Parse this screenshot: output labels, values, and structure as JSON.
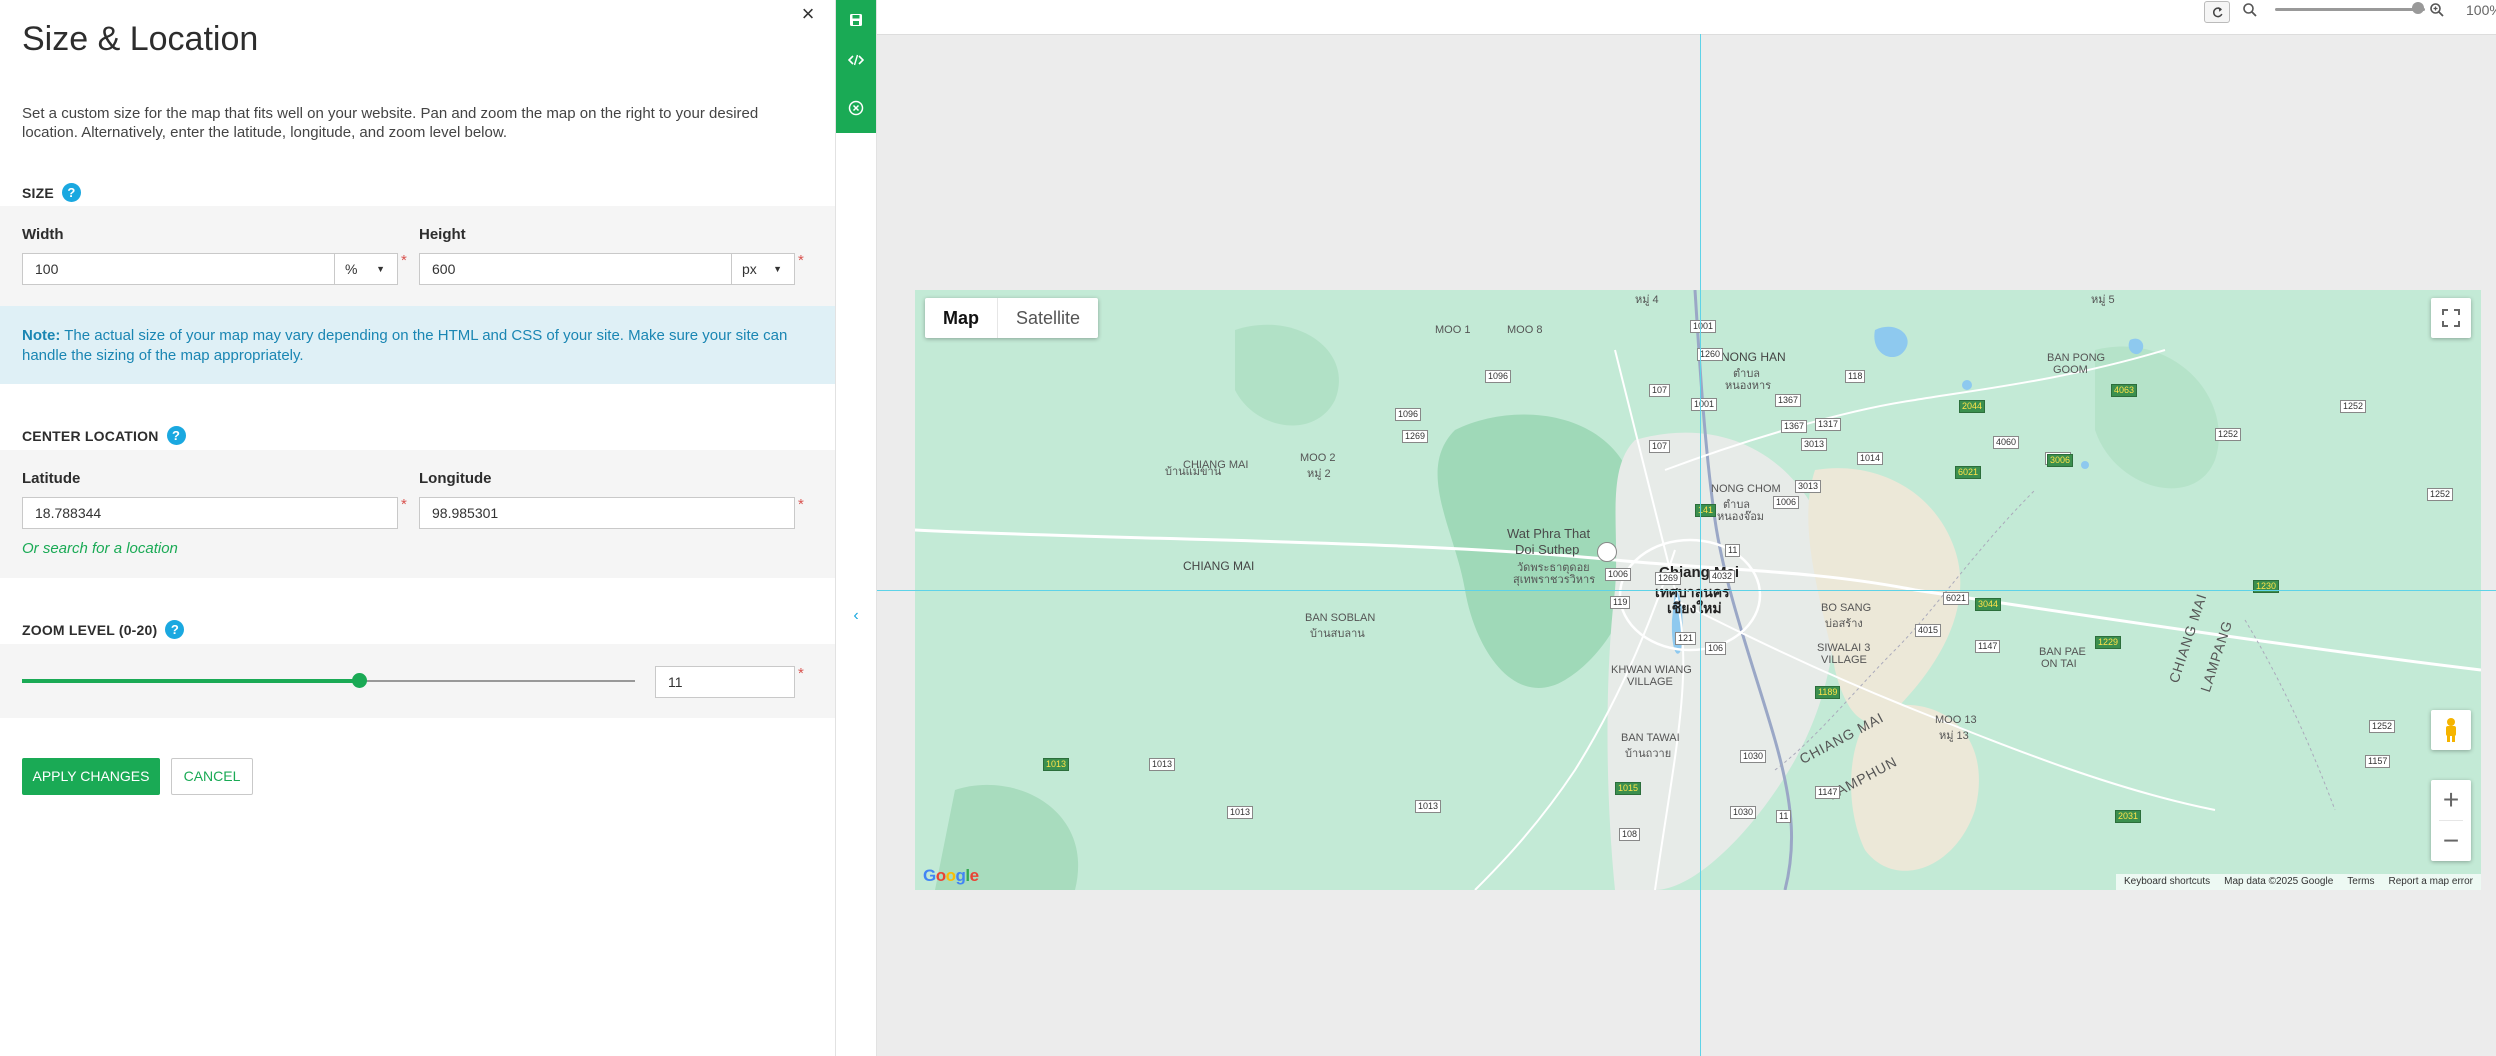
{
  "panel": {
    "title": "Size & Location",
    "close_glyph": "×",
    "intro": "Set a custom size for the map that fits well on your website. Pan and zoom the map on the right to your desired location. Alternatively, enter the latitude, longitude, and zoom level below.",
    "size": {
      "label": "SIZE",
      "width_label": "Width",
      "width_value": "100",
      "width_unit": "%",
      "height_label": "Height",
      "height_value": "600",
      "height_unit": "px"
    },
    "note": {
      "strong": "Note:",
      "text": " The actual size of your map may vary depending on the HTML and CSS of your site. Make sure your site can handle the sizing of the map appropriately."
    },
    "center": {
      "label": "CENTER LOCATION",
      "lat_label": "Latitude",
      "lat_value": "18.788344",
      "lng_label": "Longitude",
      "lng_value": "98.985301",
      "search_link": "Or search for a location"
    },
    "zoom": {
      "label": "ZOOM LEVEL (0-20)",
      "value": "11",
      "min": 0,
      "max": 20
    },
    "help_glyph": "?",
    "required_mark": "*",
    "apply_label": "APPLY CHANGES",
    "cancel_label": "CANCEL"
  },
  "strip": {
    "tools": [
      "save-icon",
      "code-icon",
      "close-circle-icon"
    ],
    "collapse_glyph": "‹"
  },
  "preview": {
    "zoom_percent": "100%",
    "zoom_level": 0.9
  },
  "map": {
    "type_buttons": [
      "Map",
      "Satellite"
    ],
    "active_type": "Map",
    "city": "Chiang Mai",
    "city_thai_1": "เทศบาลนคร",
    "city_thai_2": "เชียงใหม่",
    "labels": {
      "chiang_mai_west": "CHIANG MAI",
      "nong_han": "NONG HAN",
      "nong_han_th1": "ตำบล",
      "nong_han_th2": "หนองหาร",
      "wat_1": "Wat Phra That",
      "wat_2": "Doi Suthep",
      "wat_th1": "วัดพระธาตุดอย",
      "wat_th2": "สุเทพราชวรวิหาร",
      "ban_soblan": "BAN SOBLAN",
      "ban_soblan_th": "บ้านสบลาน",
      "moo_2": "MOO 2",
      "moo_2_th": "หมู่ 2",
      "ban_mae_khan": "บ้านแม่ขาน",
      "nong_chom": "NONG CHOM",
      "nong_chom_th1": "ตำบล",
      "nong_chom_th2": "หนองจ๊อม",
      "bo_sang": "BO SANG",
      "bo_sang_th": "บ่อสร้าง",
      "siwalai_1": "SIWALAI 3",
      "siwalai_2": "VILLAGE",
      "khwan_1": "KHWAN WIANG",
      "khwan_2": "VILLAGE",
      "ban_tawai": "BAN TAWAI",
      "ban_tawai_th": "บ้านถวาย",
      "ban_pae_1": "BAN PAE",
      "ban_pae_2": "ON TAI",
      "moo_13": "MOO 13",
      "moo_13_th": "หมู่ 13",
      "ban_pong_1": "BAN PONG",
      "ban_pong_2": "GOOM",
      "moo_1": "MOO 1",
      "moo_8": "MOO 8",
      "moo_5": "หมู่ 5",
      "moo_4": "หมู่ 4",
      "chiang_mai_diag": "CHIANG MAI",
      "lamphun": "LAMPHUN",
      "chiang_mai_vert": "CHIANG MAI",
      "lampang": "LAMPANG"
    },
    "road_signs": [
      "1001",
      "1260",
      "1096",
      "107",
      "1001",
      "1367",
      "1096",
      "1269",
      "118",
      "107",
      "1317",
      "1367",
      "3013",
      "1014",
      "4060",
      "4041",
      "6021",
      "3013",
      "1006",
      "141",
      "11",
      "1006",
      "1269",
      "4032",
      "121",
      "106",
      "119",
      "6021",
      "3044",
      "4015",
      "1147",
      "1229",
      "1189",
      "1013",
      "1013",
      "1030",
      "1015",
      "1147",
      "1013",
      "1013",
      "108",
      "1030",
      "11",
      "2031",
      "1157",
      "1252",
      "1252",
      "1252",
      "1252",
      "1230",
      "2044",
      "3006",
      "4063"
    ],
    "footer": [
      "Keyboard shortcuts",
      "Map data ©2025 Google",
      "Terms",
      "Report a map error"
    ],
    "logo": "Google",
    "zoom_in": "+",
    "zoom_out": "−"
  },
  "colors": {
    "accent": "#1aaa55",
    "help": "#1aa8e0",
    "note_bg": "#dff0f6",
    "note_text": "#1a86b3",
    "map_green": "#bfe7d4",
    "guide": "#5ed3e8"
  }
}
